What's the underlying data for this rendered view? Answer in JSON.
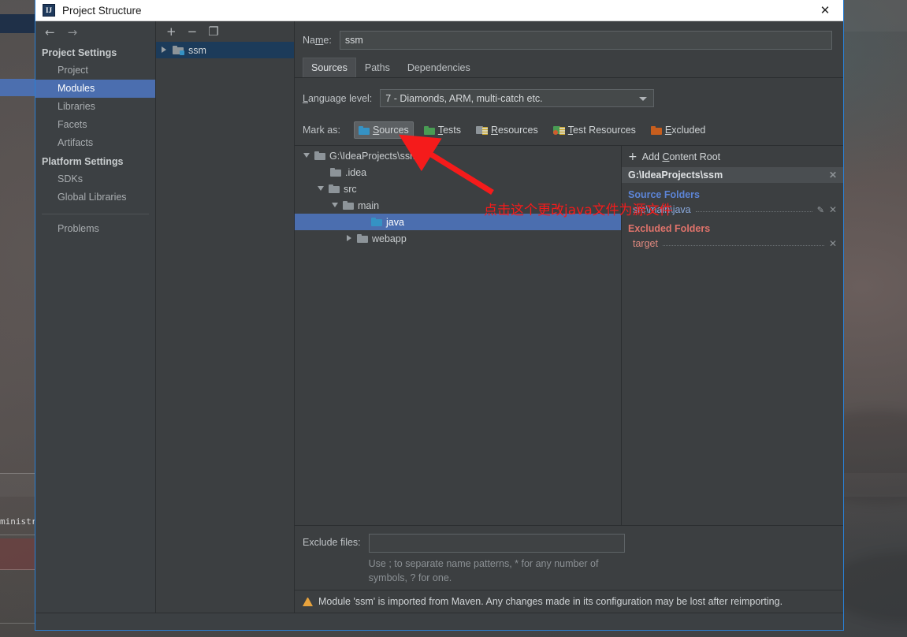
{
  "window": {
    "title": "Project Structure",
    "app_icon": "intellij-idea-icon",
    "close_label": "✕"
  },
  "nav": {
    "back_icon": "←",
    "forward_icon": "→"
  },
  "sidebar": {
    "groups": [
      {
        "title": "Project Settings",
        "items": [
          {
            "label": "Project",
            "selected": false
          },
          {
            "label": "Modules",
            "selected": true
          },
          {
            "label": "Libraries",
            "selected": false
          },
          {
            "label": "Facets",
            "selected": false
          },
          {
            "label": "Artifacts",
            "selected": false
          }
        ]
      },
      {
        "title": "Platform Settings",
        "items": [
          {
            "label": "SDKs",
            "selected": false
          },
          {
            "label": "Global Libraries",
            "selected": false
          }
        ]
      }
    ],
    "problems": {
      "label": "Problems"
    }
  },
  "module_list": {
    "toolbar": {
      "add": "+",
      "remove": "−",
      "copy": "❐"
    },
    "items": [
      {
        "label": "ssm",
        "expander": "right",
        "selected": true
      }
    ]
  },
  "name_field": {
    "label_pre": "Na",
    "label_mnemonic": "m",
    "label_post": "e:",
    "value": "ssm",
    "placeholder": ""
  },
  "tabs": [
    {
      "label": "Sources",
      "active": true
    },
    {
      "label": "Paths",
      "active": false
    },
    {
      "label": "Dependencies",
      "active": false
    }
  ],
  "language_level": {
    "label_mnemonic": "L",
    "label_rest": "anguage level:",
    "value": "7 - Diamonds, ARM, multi-catch etc."
  },
  "mark_as": {
    "label": "Mark as:",
    "options": [
      {
        "label_mnemonic": "S",
        "label_rest": "ources",
        "icon": "folder-blue-icon",
        "active": true
      },
      {
        "label_mnemonic": "T",
        "label_rest": "ests",
        "icon": "folder-green-icon",
        "active": false
      },
      {
        "label_mnemonic": "R",
        "label_rest": "esources",
        "icon": "resources-icon",
        "active": false
      },
      {
        "label_mnemonic": "T",
        "label_rest": "est Resources",
        "icon": "test-resources-icon",
        "active": false
      },
      {
        "label_mnemonic": "E",
        "label_rest": "xcluded",
        "icon": "folder-orange-icon",
        "active": false
      }
    ]
  },
  "tree": [
    {
      "label": "G:\\IdeaProjects\\ssm",
      "depth": 0,
      "expander": "down",
      "icon": "folder-grey-icon",
      "selected": false
    },
    {
      "label": ".idea",
      "depth": 1,
      "expander": "none",
      "icon": "folder-grey-icon",
      "selected": false
    },
    {
      "label": "src",
      "depth": 1,
      "expander": "down",
      "icon": "folder-grey-icon",
      "selected": false
    },
    {
      "label": "main",
      "depth": 2,
      "expander": "down",
      "icon": "folder-grey-icon",
      "selected": false
    },
    {
      "label": "java",
      "depth": 3,
      "expander": "none",
      "icon": "folder-blue-icon",
      "selected": true
    },
    {
      "label": "webapp",
      "depth": 3,
      "expander": "right",
      "icon": "folder-grey-icon",
      "selected": false
    }
  ],
  "roots_panel": {
    "add_content_root": {
      "plus": "+",
      "label_pre": "Add ",
      "label_mnemonic": "C",
      "label_post": "ontent Root"
    },
    "content_root": "G:\\IdeaProjects\\ssm",
    "close_icon": "✕",
    "source_folders": {
      "title": "Source Folders",
      "entries": [
        {
          "name": "src\\main\\java",
          "has_pencil": true
        }
      ]
    },
    "excluded_folders": {
      "title": "Excluded Folders",
      "entries": [
        {
          "name": "target",
          "has_pencil": false
        }
      ]
    }
  },
  "exclude_files": {
    "label": "Exclude files:",
    "value": "",
    "hint": "Use ; to separate name patterns, * for any number of symbols, ? for one."
  },
  "warning": {
    "icon": "warning-triangle-icon",
    "text": "Module 'ssm' is imported from Maven. Any changes made in its configuration may be lost after reimporting."
  },
  "annotation": {
    "text": "点击这个更改java文件为源文件",
    "color": "#f51b1b",
    "arrow": "red-arrow-annotation"
  },
  "background_window": {
    "text_fragment": "ministra"
  },
  "colors": {
    "dialog_border": "#2a7fd4",
    "panel_bg": "#3c3f41",
    "selection_blue": "#4b6eaf",
    "module_selection": "#1c3b5a",
    "source_blue": "#5c84d6",
    "excluded_red": "#e0736b",
    "warning_orange": "#e8a33d"
  }
}
